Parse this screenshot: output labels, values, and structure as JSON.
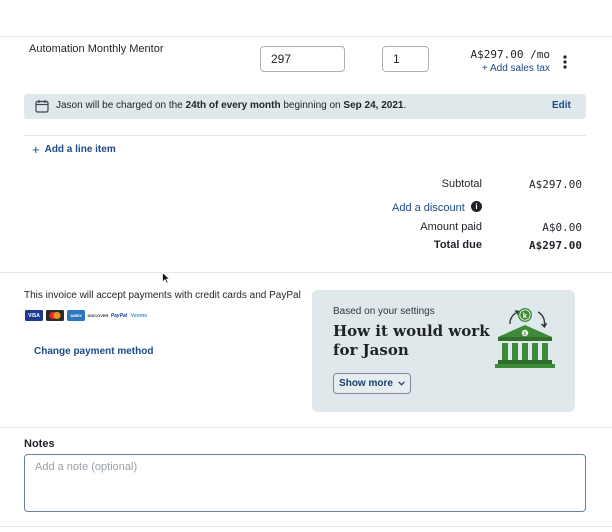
{
  "line_item": {
    "name": "Automation Monthly Mentor",
    "price": "297",
    "quantity": "1",
    "amount": "A$297.00 /mo",
    "add_tax_label": "+ Add sales tax",
    "more_icon": "vertical-ellipsis-icon"
  },
  "schedule_notice": {
    "icon": "calendar-icon",
    "text_prefix": "Jason will be charged on the ",
    "text_bold_1": "24th of every month",
    "text_mid": " beginning on ",
    "text_bold_2": "Sep 24, 2021",
    "text_suffix": ".",
    "edit_label": "Edit"
  },
  "add_line_item_label": "Add a line item",
  "summary": {
    "subtotal_label": "Subtotal",
    "subtotal_value": "A$297.00",
    "discount_label": "Add a discount",
    "amount_paid_label": "Amount paid",
    "amount_paid_value": "A$0.00",
    "total_due_label": "Total due",
    "total_due_value": "A$297.00"
  },
  "payment": {
    "description": "This invoice will accept payments with credit cards and PayPal",
    "methods": [
      "VISA",
      "MC",
      "AMEX",
      "DISCOVER",
      "PayPal",
      "Venmo"
    ],
    "change_label": "Change payment method"
  },
  "info_card": {
    "eyebrow": "Based on your settings",
    "title_line1": "How it would work",
    "title_line2": "for Jason",
    "show_more_label": "Show more",
    "illustration": "bank-icon"
  },
  "notes": {
    "label": "Notes",
    "placeholder": "Add a note (optional)"
  },
  "colors": {
    "accent": "#1b4a86",
    "panel_bg": "#dfe8ea",
    "bank_green": "#3f8a3a"
  }
}
